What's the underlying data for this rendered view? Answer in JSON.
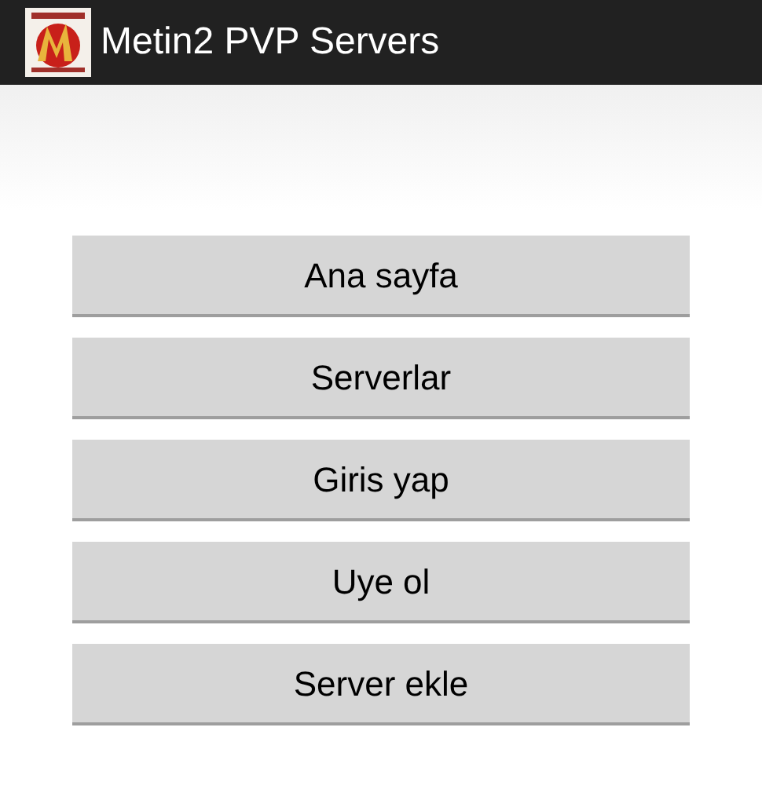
{
  "action_bar": {
    "title": "Metin2 PVP Servers"
  },
  "buttons": [
    {
      "label": "Ana sayfa"
    },
    {
      "label": "Serverlar"
    },
    {
      "label": "Giris yap"
    },
    {
      "label": "Uye ol"
    },
    {
      "label": "Server ekle"
    }
  ]
}
